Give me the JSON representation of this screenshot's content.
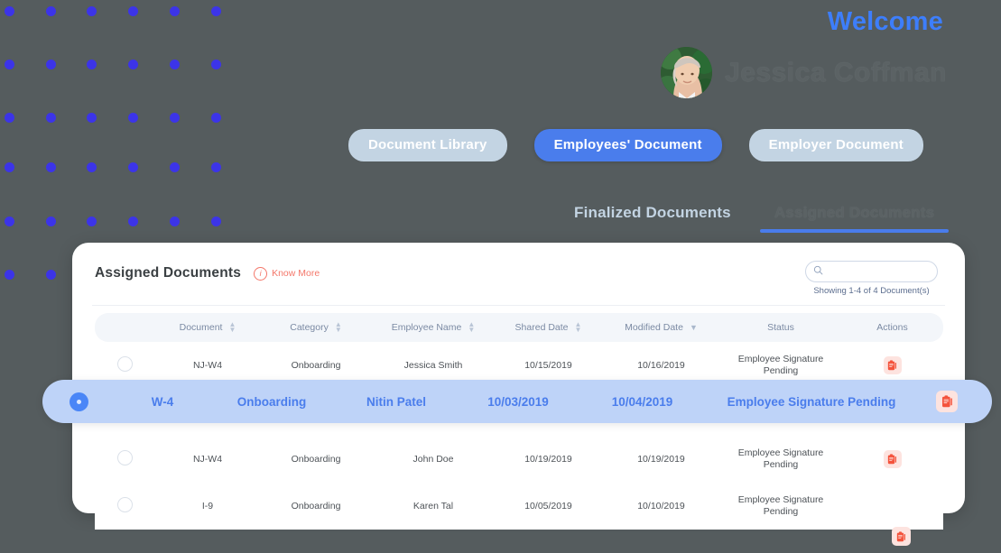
{
  "theme": {
    "page_bg": "#555c5e",
    "accent_blue": "#4a7dec",
    "dot_blue": "#3c34e8",
    "coral": "#f4776a",
    "pill_inactive": "#c3d4e3",
    "highlight_row_bg": "#bed3f8"
  },
  "header": {
    "welcome": "Welcome",
    "user_name": "Jessica Coffman",
    "avatar_name": "user-avatar"
  },
  "doc_tabs": [
    {
      "label": "Document Library",
      "active": false
    },
    {
      "label": "Employees' Document",
      "active": true
    },
    {
      "label": "Employer Document",
      "active": false
    }
  ],
  "section_tabs": [
    {
      "label": "Finalized Documents",
      "active": false
    },
    {
      "label": "Assigned Documents",
      "active": true
    }
  ],
  "card": {
    "title": "Assigned Documents",
    "know_more": "Know More",
    "know_more_icon": "info-circle-icon",
    "search": {
      "value": "",
      "placeholder": "",
      "icon": "search-icon"
    },
    "showing": "Showing 1-4 of 4 Document(s)"
  },
  "table": {
    "columns": [
      {
        "label": "",
        "sort": "none"
      },
      {
        "label": "Document",
        "sort": "both"
      },
      {
        "label": "Category",
        "sort": "both"
      },
      {
        "label": "Employee Name",
        "sort": "both"
      },
      {
        "label": "Shared Date",
        "sort": "both"
      },
      {
        "label": "Modified Date",
        "sort": "down"
      },
      {
        "label": "Status",
        "sort": "none"
      },
      {
        "label": "Actions",
        "sort": "none"
      }
    ],
    "rows": [
      {
        "selected": false,
        "document": "NJ-W4",
        "category": "Onboarding",
        "employee_name": "Jessica Smith",
        "shared_date": "10/15/2019",
        "modified_date": "10/16/2019",
        "status": "Employee Signature Pending",
        "action_icon": "clipboard-icon",
        "has_action": true
      },
      {
        "selected": true,
        "document": "W-4",
        "category": "Onboarding",
        "employee_name": "Nitin Patel",
        "shared_date": "10/03/2019",
        "modified_date": "10/04/2019",
        "status": "Employee Signature Pending",
        "action_icon": "clipboard-icon",
        "has_action": true
      },
      {
        "selected": false,
        "document": "NJ-W4",
        "category": "Onboarding",
        "employee_name": "John Doe",
        "shared_date": "10/19/2019",
        "modified_date": "10/19/2019",
        "status": "Employee Signature Pending",
        "action_icon": "clipboard-icon",
        "has_action": true
      },
      {
        "selected": false,
        "document": "I-9",
        "category": "Onboarding",
        "employee_name": "Karen Tal",
        "shared_date": "10/05/2019",
        "modified_date": "10/10/2019",
        "status": "Employee Signature Pending",
        "action_icon": "clipboard-icon",
        "has_action": false
      }
    ]
  },
  "floating_action": {
    "icon": "clipboard-icon"
  },
  "dot_grid": {
    "xs": [
      5,
      51,
      96,
      142,
      188,
      234
    ],
    "ys": [
      7,
      66,
      125,
      180,
      240,
      299
    ]
  }
}
